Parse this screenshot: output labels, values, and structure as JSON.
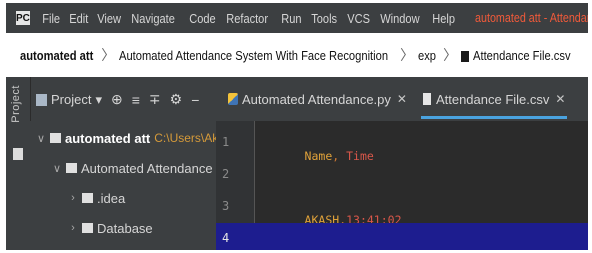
{
  "menubar": {
    "app_icon_glyph": "PC",
    "items": [
      "File",
      "Edit",
      "View",
      "Navigate",
      "Code",
      "Refactor",
      "Run",
      "Tools",
      "VCS",
      "Window",
      "Help"
    ],
    "window_title": "automated att - Attendance File.csv"
  },
  "breadcrumb": {
    "items": [
      "automated att",
      "Automated Attendance System With Face Recognition",
      "exp",
      "Attendance File.csv"
    ],
    "separator": "〉"
  },
  "tool_window": {
    "side_label": "Project",
    "header": "Project",
    "dropdown_glyph": "▾",
    "tools": [
      "⊕",
      "≡",
      "∓",
      "⚙",
      "−"
    ]
  },
  "tabs": [
    {
      "label": "Automated Attendance.py",
      "icon": "python-file-icon",
      "close": "✕"
    },
    {
      "label": "Attendance File.csv",
      "icon": "csv-file-icon",
      "close": "✕"
    }
  ],
  "tree": [
    {
      "label": "automated att",
      "path": "C:\\Users\\Akash Si",
      "expanded": true,
      "chev": "∨"
    },
    {
      "label": "Automated Attendance System",
      "expanded": true,
      "chev": "∨"
    },
    {
      "label": ".idea",
      "expanded": false,
      "chev": "›"
    },
    {
      "label": "Database",
      "expanded": false,
      "chev": "›"
    }
  ],
  "editor": {
    "line_numbers": [
      "1",
      "2",
      "3",
      "4"
    ],
    "line1": {
      "name": "Name",
      "comma": ",",
      "time": " Time"
    },
    "line3": {
      "name": "AKASH",
      "comma": ",",
      "time": "13:41:02"
    }
  },
  "colors": {
    "accent_tab_underline": "#4aa3df",
    "title_orange": "#f05a3a",
    "csv_col1": "#e0a23a",
    "csv_col2": "#d9574a",
    "current_line": "#1d1d8f"
  }
}
